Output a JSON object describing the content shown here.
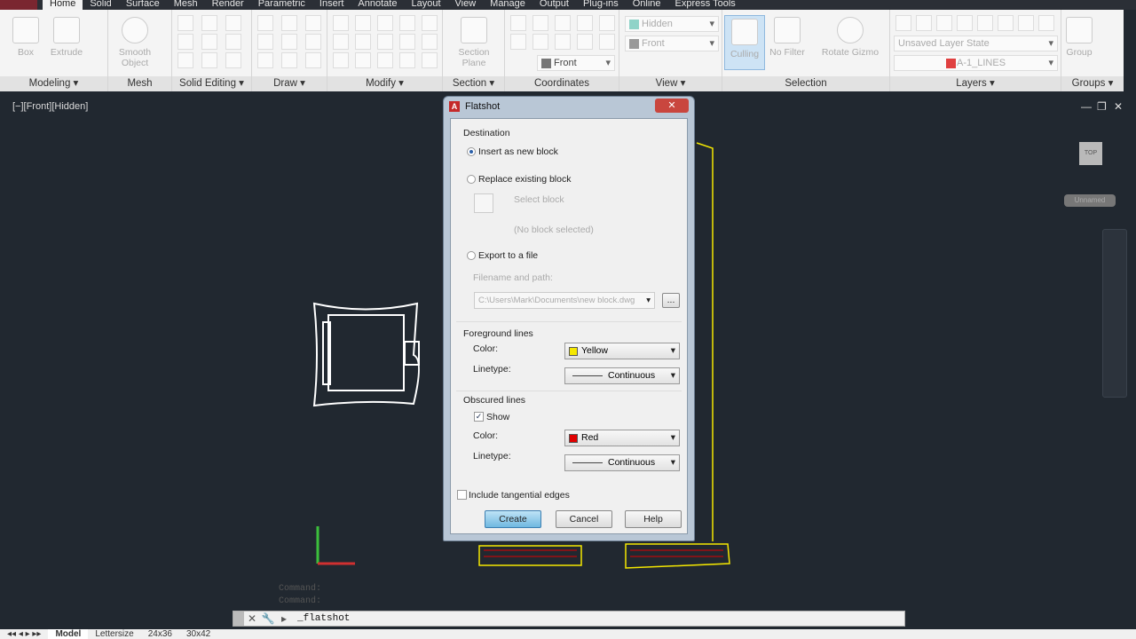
{
  "ribbon_tabs": [
    "Home",
    "Solid",
    "Surface",
    "Mesh",
    "Render",
    "Parametric",
    "Insert",
    "Annotate",
    "Layout",
    "View",
    "Manage",
    "Output",
    "Plug-ins",
    "Online",
    "Express Tools"
  ],
  "active_tab": "Home",
  "panels": {
    "modeling": {
      "label": "Modeling ▾",
      "tools": [
        "Box",
        "Extrude"
      ]
    },
    "mesh": {
      "label": "Mesh",
      "tools": [
        "Smooth Object"
      ]
    },
    "solid_editing": {
      "label": "Solid Editing ▾"
    },
    "draw": {
      "label": "Draw ▾"
    },
    "modify": {
      "label": "Modify ▾"
    },
    "section": {
      "label": "Section ▾",
      "tools": [
        "Section Plane"
      ]
    },
    "coordinates": {
      "label": "Coordinates",
      "combo": "Front"
    },
    "view": {
      "label": "View ▾",
      "visual_style": "Hidden",
      "view": "Front"
    },
    "selection": {
      "label": "Selection",
      "tools": [
        "Culling",
        "No Filter",
        "Rotate Gizmo"
      ]
    },
    "layers": {
      "label": "Layers ▾",
      "layer_state": "Unsaved Layer State",
      "layer": "A-1_LINES"
    },
    "groups": {
      "label": "Groups ▾",
      "tools": [
        "Group"
      ]
    }
  },
  "viewport": {
    "label": "[−][Front][Hidden]",
    "viewcube": "TOP",
    "ucs_name": "Unnamed"
  },
  "command": {
    "history": [
      "Command:",
      "Command:"
    ],
    "current": "_flatshot"
  },
  "layout_tabs": [
    "Model",
    "Lettersize",
    "24x36",
    "30x42"
  ],
  "dialog": {
    "title": "Flatshot",
    "destination": "Destination",
    "insert_new": "Insert as new block",
    "replace_existing": "Replace existing block",
    "select_block": "Select block",
    "no_block": "(No block selected)",
    "export_file": "Export to a file",
    "filename_label": "Filename and path:",
    "filename": "C:\\Users\\Mark\\Documents\\new block.dwg",
    "browse": "...",
    "foreground": "Foreground lines",
    "fg_color_label": "Color:",
    "fg_color": "Yellow",
    "fg_linetype_label": "Linetype:",
    "fg_linetype": "Continuous",
    "obscured": "Obscured lines",
    "show": "Show",
    "ob_color_label": "Color:",
    "ob_color": "Red",
    "ob_linetype_label": "Linetype:",
    "ob_linetype": "Continuous",
    "tangential": "Include tangential edges",
    "create": "Create",
    "cancel": "Cancel",
    "help": "Help"
  },
  "colors": {
    "yellow": "#f5e800",
    "red": "#e00000",
    "viewport_bg": "#212830",
    "accent": "#6fb8e0"
  }
}
